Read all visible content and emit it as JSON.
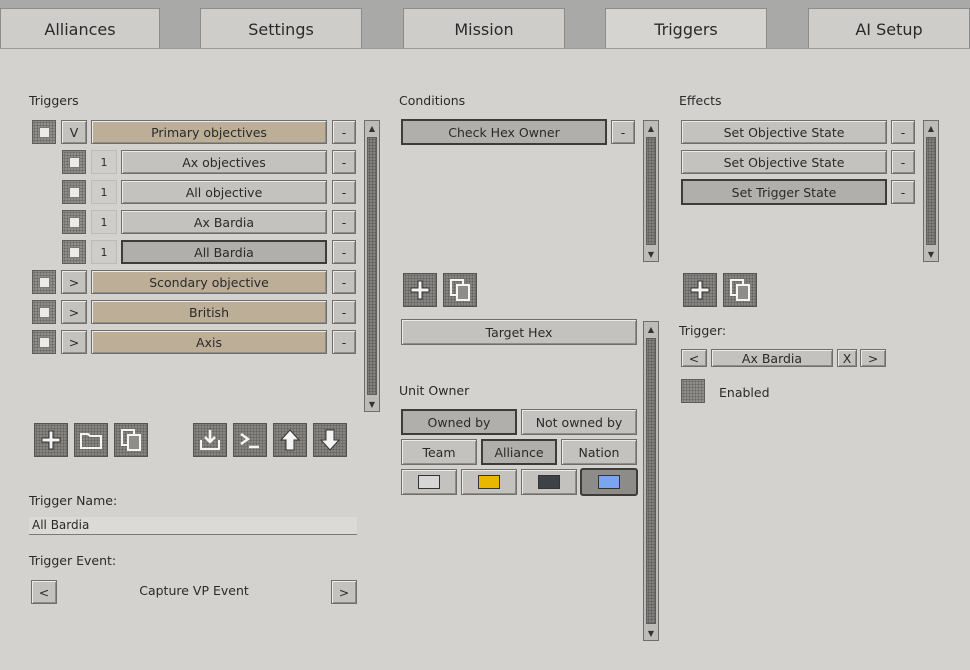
{
  "tabs": [
    {
      "label": "Alliances"
    },
    {
      "label": "Settings"
    },
    {
      "label": "Mission"
    },
    {
      "label": "Triggers"
    },
    {
      "label": "AI Setup"
    }
  ],
  "triggers": {
    "header": "Triggers",
    "rows": [
      {
        "toggle": "V",
        "label": "Primary objectives",
        "remove": "-"
      },
      {
        "count": "1",
        "label": "Ax objectives",
        "remove": "-"
      },
      {
        "count": "1",
        "label": "All objective",
        "remove": "-"
      },
      {
        "count": "1",
        "label": "Ax Bardia",
        "remove": "-"
      },
      {
        "count": "1",
        "label": "All Bardia",
        "remove": "-"
      },
      {
        "toggle": ">",
        "label": "Scondary objective",
        "remove": "-"
      },
      {
        "toggle": ">",
        "label": "British",
        "remove": "-"
      },
      {
        "toggle": ">",
        "label": "Axis",
        "remove": "-"
      }
    ],
    "name_label": "Trigger Name:",
    "name_value": "All Bardia",
    "event_label": "Trigger Event:",
    "event_prev": "<",
    "event_value": "Capture VP Event",
    "event_next": ">"
  },
  "conditions": {
    "header": "Conditions",
    "items": [
      {
        "label": "Check Hex Owner",
        "remove": "-"
      }
    ],
    "target_hex": "Target Hex",
    "unit_owner_label": "Unit Owner",
    "owned_by": "Owned by",
    "not_owned_by": "Not owned by",
    "team": "Team",
    "alliance": "Alliance",
    "nation": "Nation",
    "colors": [
      "#d7d7d7",
      "#e8b800",
      "#3d4249",
      "#7aa6ef"
    ]
  },
  "effects": {
    "header": "Effects",
    "items": [
      {
        "label": "Set Objective State",
        "remove": "-"
      },
      {
        "label": "Set Objective State",
        "remove": "-"
      },
      {
        "label": "Set Trigger State",
        "remove": "-"
      }
    ],
    "trigger_label": "Trigger:",
    "trigger_prev": "<",
    "trigger_value": "Ax Bardia",
    "trigger_clear": "X",
    "trigger_next": ">",
    "enabled_label": "Enabled"
  }
}
